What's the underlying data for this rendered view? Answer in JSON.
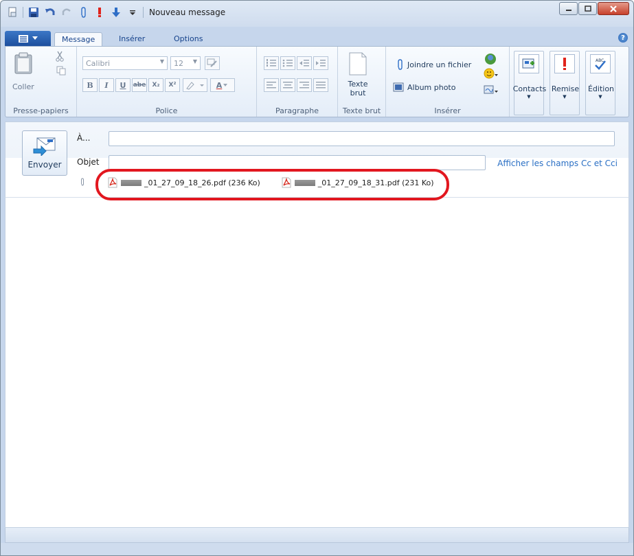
{
  "window": {
    "title": "Nouveau message"
  },
  "tabs": [
    "Message",
    "Insérer",
    "Options"
  ],
  "help_label": "?",
  "clipboard": {
    "paste_label": "Coller",
    "group_label": "Presse-papiers"
  },
  "font": {
    "family": "Calibri",
    "size": "12",
    "bold": "B",
    "italic": "I",
    "underline": "U",
    "strike": "abe",
    "subscript": "X₂",
    "superscript": "X²",
    "color_label": "A",
    "group_label": "Police"
  },
  "paragraph": {
    "group_label": "Paragraphe"
  },
  "plain_text": {
    "label_line1": "Texte",
    "label_line2": "brut",
    "group_label": "Texte brut"
  },
  "insert": {
    "attach_label": "Joindre un fichier",
    "album_label": "Album photo",
    "group_label": "Insérer"
  },
  "big_buttons": {
    "contacts": "Contacts",
    "remise": "Remise",
    "edition": "Édition"
  },
  "compose": {
    "send_label": "Envoyer",
    "to_label": "À...",
    "subject_label": "Objet",
    "to_value": "",
    "subject_value": "",
    "show_cc_label": "Afficher les champs Cc et Cci"
  },
  "attachments": [
    {
      "name": "_01_27_09_18_26.pdf (236 Ko)"
    },
    {
      "name": "_01_27_09_18_31.pdf (231 Ko)"
    }
  ],
  "colors": {
    "accent": "#2a6fc4",
    "highlight": "#e2171f",
    "pdf": "#d62b1f"
  }
}
